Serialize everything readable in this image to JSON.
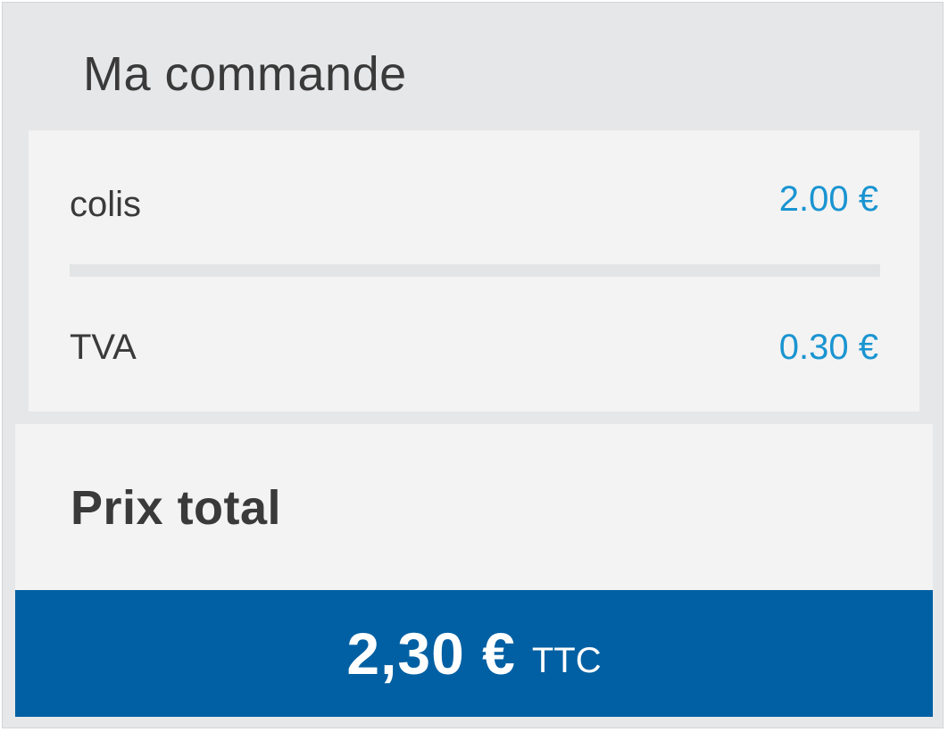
{
  "order": {
    "title": "Ma commande",
    "lines": [
      {
        "label": "colis",
        "amount": "2.00 €"
      },
      {
        "label": "TVA",
        "amount": "0.30 €"
      }
    ]
  },
  "total": {
    "label": "Prix total",
    "amount": "2,30 €",
    "suffix": "TTC"
  },
  "colors": {
    "panel_background": "#e6e7e8",
    "card_background": "#f3f3f3",
    "text": "#3a3a3a",
    "amount_accent": "#1a94d1",
    "total_bar": "#0060a3",
    "total_text": "#ffffff"
  }
}
